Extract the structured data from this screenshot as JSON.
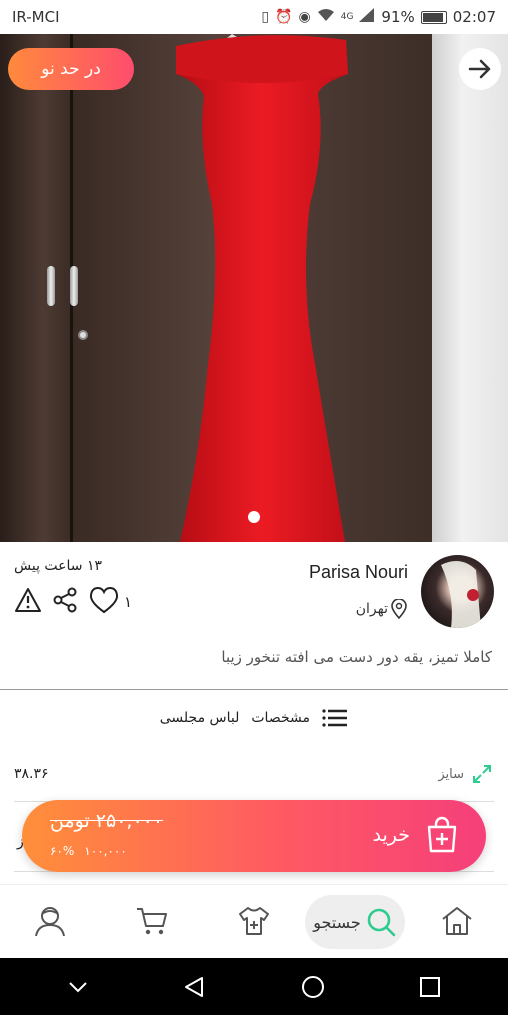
{
  "status_bar": {
    "carrier": "IR-MCI",
    "battery_percent": "91%",
    "time": "02:07",
    "network_type": "4G"
  },
  "hero": {
    "badge": "در حد نو",
    "image_count": 1,
    "current_image": 1
  },
  "seller": {
    "name": "Parisa Nouri",
    "city": "تهران",
    "posted_time": "۱۳ ساعت پیش",
    "like_count": "۱"
  },
  "description": "کاملا تمیز، یقه دور دست می افته تنخور زیبا",
  "specs": {
    "header_label": "مشخصات",
    "category": "لباس مجلسی",
    "rows": [
      {
        "label": "سایز",
        "value": "۳۸.۳۶"
      }
    ],
    "partial_row_value": "ز"
  },
  "buy_bar": {
    "price_old": "۲۵۰,۰۰۰ تومن",
    "discount": "۶۰%",
    "price_new": "۱۰۰,۰۰۰",
    "buy_label": "خرید"
  },
  "bottom_nav": {
    "search_label": "جستجو",
    "items": [
      "home",
      "search",
      "add-item",
      "cart",
      "profile"
    ]
  },
  "icons": {
    "back": "arrow-right-icon",
    "location": "location-pin-icon",
    "report": "warning-icon",
    "share": "share-icon",
    "like": "heart-icon",
    "specs": "list-icon",
    "size": "expand-icon",
    "buy": "bag-plus-icon"
  },
  "colors": {
    "accent_start": "#ff8f3a",
    "accent_end": "#f53f7a",
    "nav_search_highlight": "#2ecc8f",
    "dress": "#e0141c"
  }
}
